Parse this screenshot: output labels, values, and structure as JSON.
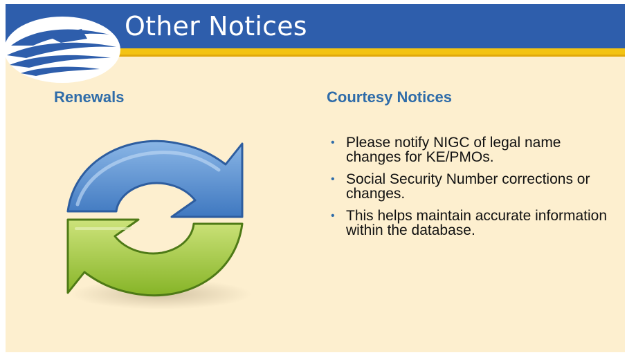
{
  "header": {
    "title": "Other Notices"
  },
  "renewals": {
    "heading": "Renewals",
    "icon": "refresh-cycle-icon"
  },
  "courtesy": {
    "heading": "Courtesy Notices",
    "bullet_marker": "•",
    "items": [
      "Please notify NIGC of legal name changes for KE/PMOs.",
      "Social Security Number corrections or changes.",
      "This helps maintain accurate information within the database."
    ]
  },
  "colors": {
    "header_blue": "#2e5eac",
    "stripe_gold": "#f3c313",
    "background_cream": "#fdefcf",
    "heading_blue": "#2f6ca9",
    "arrow_blue": "#5b93d3",
    "arrow_green": "#9ec43a"
  }
}
